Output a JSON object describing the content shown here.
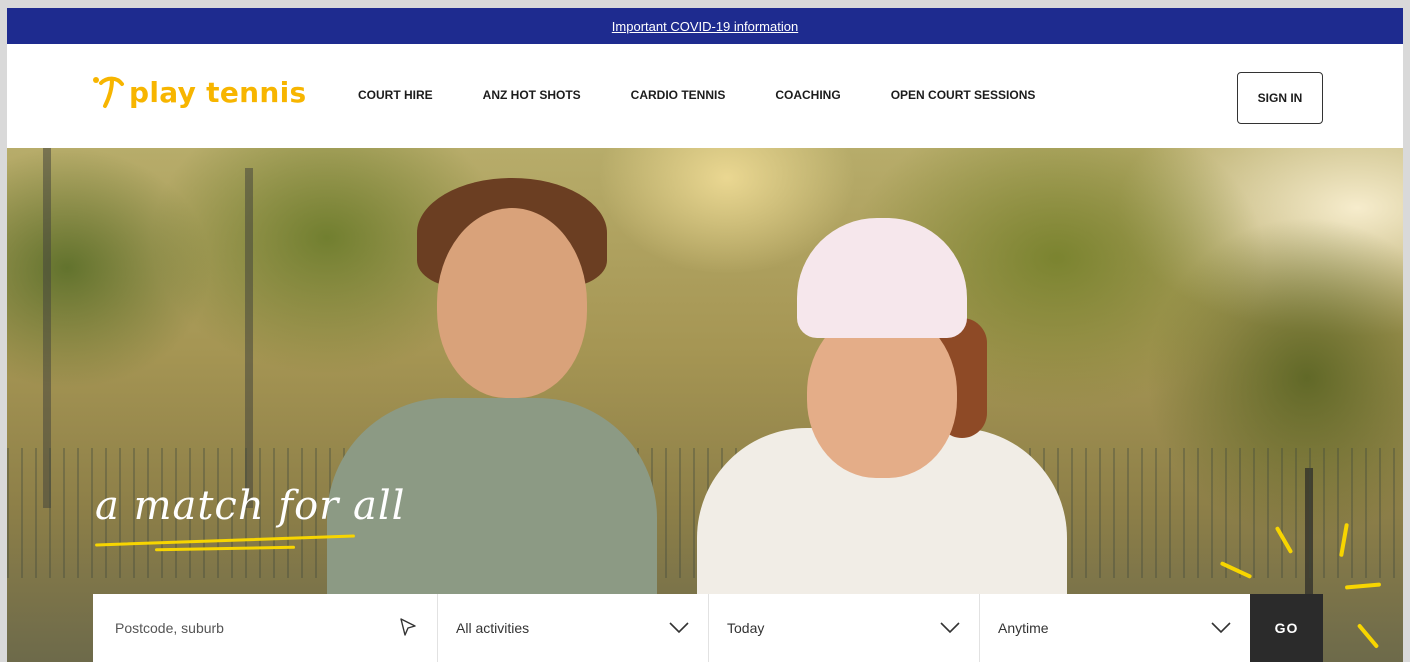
{
  "banner": {
    "link_text": "Important COVID-19 information"
  },
  "header": {
    "logo_text": "play tennis",
    "nav": [
      {
        "label": "COURT HIRE"
      },
      {
        "label": "ANZ HOT SHOTS"
      },
      {
        "label": "CARDIO TENNIS"
      },
      {
        "label": "COACHING"
      },
      {
        "label": "OPEN COURT SESSIONS"
      }
    ],
    "sign_in_label": "SIGN IN"
  },
  "hero": {
    "tagline": "a match for all"
  },
  "search": {
    "location_placeholder": "Postcode, suburb",
    "activity_value": "All activities",
    "date_value": "Today",
    "time_value": "Anytime",
    "go_label": "GO"
  },
  "colors": {
    "brand_yellow": "#f7b500",
    "banner_navy": "#1e2b8f",
    "go_button": "#2b2b2b"
  },
  "icons": {
    "location": "location-arrow-icon",
    "dropdown": "chevron-down-icon",
    "logo": "play-tennis-logo-icon"
  }
}
